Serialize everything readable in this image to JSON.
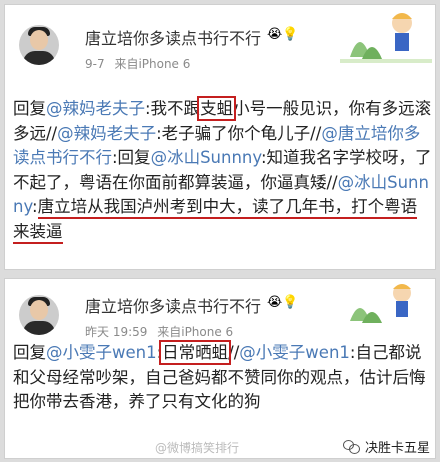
{
  "post1": {
    "author": "唐立培你多读点书行不行",
    "emoji": "😭💡",
    "time": "9-7",
    "source": "来自iPhone 6",
    "seg1": "回复",
    "at1": "@辣妈老夫子",
    "seg2": ":我不跟",
    "boxed": "支蛆",
    "seg3": "小号一般见识，你有多远滚多远//",
    "at2": "@辣妈老夫子",
    "seg4": ":老子骗了你个龟儿子//",
    "at3": "@唐立培你多读点书行不行",
    "seg5": ":回复",
    "at4": "@冰山Sunnny",
    "seg6": ":知道我名字学校呀，了不起了，粤语在你面前都算装逼，你逼真矮//",
    "at5": "@冰山Sunnny",
    "seg7": ":",
    "underlined": "唐立培从我国泸州考到中大，读了几年书，打个粤语来装逼"
  },
  "post2": {
    "author": "唐立培你多读点书行不行",
    "emoji": "😭💡",
    "time": "昨天 19:59",
    "source": "来自iPhone 6",
    "seg1": "回复",
    "at1": "@小雯子wen1",
    "seg2": ":",
    "boxed": "日常晒蛆",
    "seg3": "//",
    "at2": "@小雯子wen1",
    "seg4": ":自己都说和父母经常吵架，自己爸妈都不赞同你的观点，估计后悔把你带去香港，养了只有文化的狗"
  },
  "watermark_text": "@微博搞笑排行",
  "badge_text": "决胜卡五星",
  "colors": {
    "accent": "#c41f1f",
    "mention": "#4a79b5"
  }
}
